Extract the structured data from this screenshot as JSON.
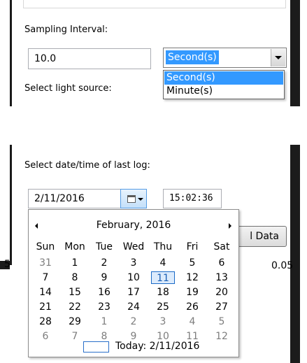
{
  "sampling": {
    "label": "Sampling Interval:",
    "value": "10.0",
    "unit_selected": "Second(s)",
    "unit_options": [
      "Second(s)",
      "Minute(s)"
    ],
    "highlighted_option": "Second(s)"
  },
  "light_source": {
    "label": "Select light source:"
  },
  "last_log": {
    "label": "Select date/time of last log:",
    "date_value": "2/11/2016",
    "time_value": "15:02:36"
  },
  "background": {
    "button_partial": "l Data",
    "number_left": "5",
    "number_right": "0.05"
  },
  "calendar": {
    "month_title": "February, 2016",
    "weekdays": [
      "Sun",
      "Mon",
      "Tue",
      "Wed",
      "Thu",
      "Fri",
      "Sat"
    ],
    "weeks": [
      [
        "31",
        "1",
        "2",
        "3",
        "4",
        "5",
        "6"
      ],
      [
        "7",
        "8",
        "9",
        "10",
        "11",
        "12",
        "13"
      ],
      [
        "14",
        "15",
        "16",
        "17",
        "18",
        "19",
        "20"
      ],
      [
        "21",
        "22",
        "23",
        "24",
        "25",
        "26",
        "27"
      ],
      [
        "28",
        "29",
        "1",
        "2",
        "3",
        "4",
        "5"
      ],
      [
        "6",
        "7",
        "8",
        "9",
        "10",
        "11",
        "12"
      ]
    ],
    "today_label": "Today: 2/11/2016",
    "selected_day": "11"
  },
  "colors": {
    "highlight": "#3399ff",
    "today_border": "#1a6ac7",
    "muted_day": "#7d7d7d"
  }
}
